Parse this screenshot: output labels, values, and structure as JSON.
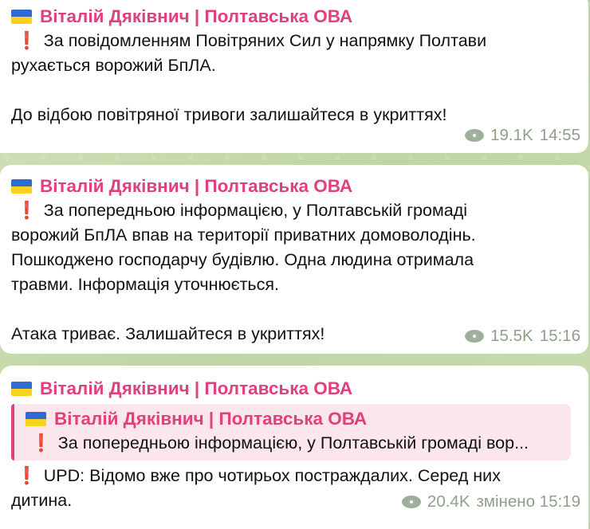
{
  "messages": [
    {
      "sender": "Віталій Дяківнич | Полтавська ОВА",
      "lines": [
        "За повідомленням Повітряних Сил у напрямку Полтави",
        "рухається ворожий БпЛА."
      ],
      "after_gap": "До відбою повітряної тривоги залишайтеся в укриттях!",
      "views": "19.1K",
      "time": "14:55"
    },
    {
      "sender": "Віталій Дяківнич | Полтавська ОВА",
      "lines": [
        "За попередньою інформацією, у Полтавській громаді",
        "ворожий БпЛА впав на території приватних домоволодінь.",
        "Пошкоджено господарчу будівлю. Одна людина отримала",
        "травми. Інформація уточнюється."
      ],
      "after_gap": "Атака триває. Залишайтеся в укриттях!",
      "views": "15.5K",
      "time": "15:16"
    },
    {
      "sender": "Віталій Дяківнич | Полтавська ОВА",
      "reply": {
        "sender": "Віталій Дяківнич | Полтавська ОВА",
        "text": "За попередньою інформацією, у Полтавській громаді вор..."
      },
      "lines": [
        "UPD: Відомо вже про чотирьох постраждалих. Серед них",
        "дитина."
      ],
      "views": "20.4K",
      "time": "змінено 15:19"
    }
  ],
  "icons": {
    "exclamation": "❗",
    "flag": "ukraine-flag-icon",
    "views": "eye-icon"
  },
  "colors": {
    "sender": "#e0407c",
    "meta": "#8fa08a",
    "reply_bg": "#fbe6ec",
    "bubble": "#ffffff"
  }
}
